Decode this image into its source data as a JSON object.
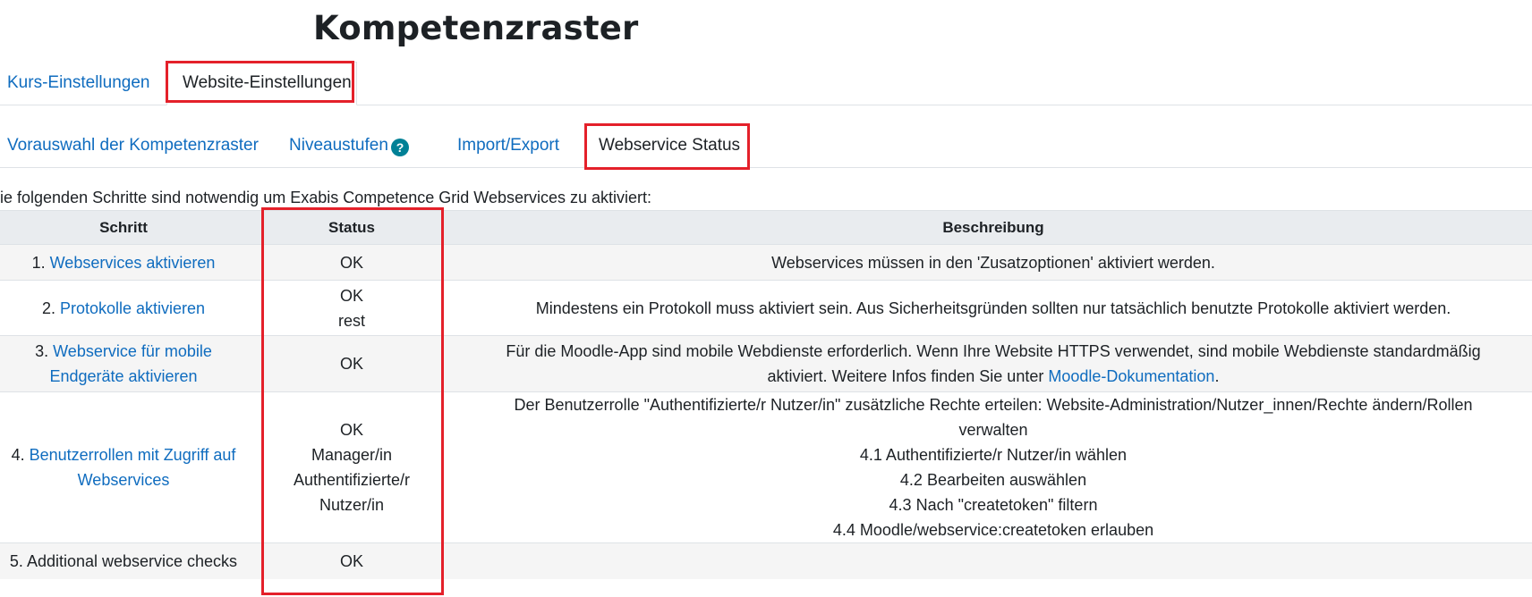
{
  "page": {
    "title": "Kompetenzraster"
  },
  "tabs_primary": [
    {
      "label": "Kurs-Einstellungen",
      "active": false
    },
    {
      "label": "Website-Einstellungen",
      "active": true
    }
  ],
  "tabs_secondary": [
    {
      "label": "Vorauswahl der Kompetenzraster",
      "active": false
    },
    {
      "label": "Niveaustufen",
      "active": false,
      "help": "?"
    },
    {
      "label": "Import/Export",
      "active": false
    },
    {
      "label": "Webservice Status",
      "active": true
    }
  ],
  "intro": "ie folgenden Schritte sind notwendig um Exabis Competence Grid Webservices zu aktiviert:",
  "table": {
    "headers": [
      "Schritt",
      "Status",
      "Beschreibung"
    ],
    "rows": [
      {
        "num": "1.",
        "link": "Webservices aktivieren",
        "status": [
          "OK"
        ],
        "desc": [
          "Webservices müssen in den 'Zusatzoptionen' aktiviert werden."
        ]
      },
      {
        "num": "2.",
        "link": "Protokolle aktivieren",
        "status": [
          "OK",
          "rest"
        ],
        "desc": [
          "Mindestens ein Protokoll muss aktiviert sein. Aus Sicherheitsgründen sollten nur tatsächlich benutzte Protokolle aktiviert werden."
        ]
      },
      {
        "num": "3.",
        "link_line1": "Webservice für mobile",
        "link_line2": "Endgeräte aktivieren",
        "status": [
          "OK"
        ],
        "desc_line1": "Für die Moodle-App sind mobile Webdienste erforderlich. Wenn Ihre Website HTTPS verwendet, sind mobile Webdienste standardmäßig",
        "desc_line2_pre": "aktiviert. Weitere Infos finden Sie unter ",
        "desc_line2_link": "Moodle-Dokumentation",
        "desc_line2_post": "."
      },
      {
        "num": "4.",
        "link_line1": "Benutzerrollen mit Zugriff auf",
        "link_line2": "Webservices",
        "status": [
          "OK",
          "Manager/in",
          "Authentifizierte/r",
          "Nutzer/in"
        ],
        "desc": [
          "Der Benutzerrolle \"Authentifizierte/r Nutzer/in\" zusätzliche Rechte erteilen: Website-Administration/Nutzer_innen/Rechte ändern/Rollen",
          "verwalten",
          "4.1 Authentifizierte/r Nutzer/in wählen",
          "4.2 Bearbeiten auswählen",
          "4.3 Nach \"createtoken\" filtern",
          "4.4 Moodle/webservice:createtoken erlauben"
        ]
      },
      {
        "label": "5. Additional webservice checks",
        "status": [
          "OK"
        ]
      }
    ]
  },
  "highlight_color": "#e4202a",
  "link_color": "#0f6cbf"
}
